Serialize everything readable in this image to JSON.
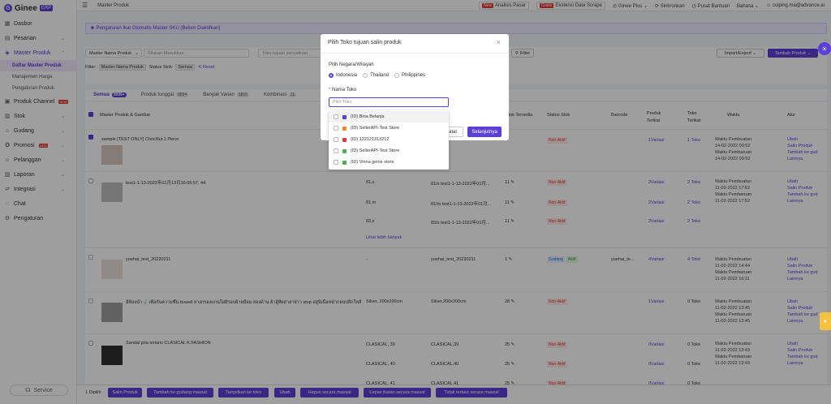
{
  "brand": {
    "name": "Ginee",
    "badge": "ERP"
  },
  "sidebar": {
    "items": [
      {
        "label": "Dasbor",
        "icon": "dashboard-icon"
      },
      {
        "label": "Pesanan",
        "icon": "orders-icon"
      },
      {
        "label": "Master Produk",
        "icon": "product-icon"
      },
      {
        "label": "Produk Channel",
        "icon": "channel-icon",
        "badge": "NEW"
      },
      {
        "label": "Stok",
        "icon": "stock-icon"
      },
      {
        "label": "Gudang",
        "icon": "warehouse-icon"
      },
      {
        "label": "Promosi",
        "icon": "promo-icon",
        "badge": "NEW"
      },
      {
        "label": "Pelanggan",
        "icon": "customer-icon"
      },
      {
        "label": "Laporan",
        "icon": "report-icon"
      },
      {
        "label": "Integrasi",
        "icon": "integration-icon"
      },
      {
        "label": "Chat",
        "icon": "chat-icon"
      },
      {
        "label": "Pengaturan",
        "icon": "settings-icon"
      }
    ],
    "subitems": [
      "Daftar Master Produk",
      "Manajemen Harga",
      "Pengaturan Produk"
    ],
    "service": "Service"
  },
  "topbar": {
    "title": "Master Produk",
    "new_tag": "New",
    "analisis": "Analisis Pasar",
    "gratis_tag": "Gratis",
    "ekstensi": "Ekstensi Data Scrape",
    "plus": "Ginee Plus",
    "sync": "Sinkronkan",
    "help": "Pusat Bantuan",
    "lang": "Bahasa",
    "user": "cuiping.ma@advance.ai"
  },
  "banner": "Pengaturan Ikat Otomatis Master SKU (Belum Diaktifkan)",
  "filters": {
    "field1": "Master Nama Produk",
    "field2": "Silakan Masukkan",
    "field3": "Toko tujuan penyalinan",
    "filter_btn": "Filter",
    "import_export": "Import/Export",
    "add_btn": "Tambah Produk",
    "filter_label": "Filter:",
    "chip1": "Master Nama Produk",
    "status_label": "Status Stok:",
    "chip2": "Semua",
    "reset": "Reset"
  },
  "tabs": [
    {
      "label": "Semua",
      "count": "9999+"
    },
    {
      "label": "Produk tunggal",
      "count": "8804"
    },
    {
      "label": "Banyak Varian",
      "count": "5815"
    },
    {
      "label": "Kombinasi",
      "count": "11"
    }
  ],
  "table": {
    "headers": [
      "Master Produk & Gambar",
      "Stok Tersedia",
      "Status Stok",
      "Barcode",
      "Produk Terikat",
      "Toko Terikat",
      "Waktu",
      "Atur"
    ],
    "rows": [
      {
        "name": "sample [TEST ONLY] ChocNut 1 Piece",
        "variants": [
          {
            "stock": "0",
            "status": "Non-Aktif",
            "produk": "1Variasi",
            "toko": "1 Toko"
          }
        ],
        "waktu": [
          "Waktu Pembuatan",
          "14-02-2022 09:52",
          "Waktu Pembaruan",
          "14-02-2022 09:52"
        ]
      },
      {
        "name": "test1-1-13-2022年01月13日16:05:57.  44",
        "variants": [
          {
            "opt": "81,s",
            "sku": "81/s test1-1-13-2022年01月...",
            "stock": "11",
            "status": "Non-Aktif",
            "produk": "2Variasi",
            "toko": "2 Toko"
          },
          {
            "opt": "81,m",
            "sku": "81/m test1-1-13-2022年01月...",
            "stock": "11",
            "status": "Non-Aktif",
            "produk": "2Variasi",
            "toko": "2 Toko"
          },
          {
            "opt": "83,s",
            "sku": "83/s test1-1-13-2022年01月...",
            "stock": "11",
            "status": "Non-Aktif",
            "produk": "2Variasi",
            "toko": "2 Toko"
          }
        ],
        "more": "Lihat lebih banyak",
        "waktu": [
          "Waktu Pembuatan",
          "11-02-2022 17:52",
          "Waktu Pembaruan",
          "11-02-2022 17:52"
        ]
      },
      {
        "name": "yuehai_test_20220211",
        "variants": [
          {
            "opt": "-",
            "sku": "yuehai_test_20220211",
            "stock": "1",
            "status": "Gudang",
            "status2": "Aktif",
            "barcode": "yuehai_te...",
            "produk": "4Variasi",
            "toko": "4 Toko"
          }
        ],
        "waktu": [
          "Waktu Pembuatan",
          "11-02-2022 14:44",
          "Waktu Pembaruan",
          "11-02-2022 16:11"
        ]
      },
      {
        "name": "มีห้องน้ำ🚽 เพื่อกันความชื้น bowell ยางกรองแกนใยมีรอบผ้ายมือม สองด้าน ผ้าอู้ที่ผลาลาย่าว stop อยู่นีเนื้อหน้ากอนปลีกใหลั้นเมลม",
        "variants": [
          {
            "opt": "Silver, 200x200cm",
            "sku": "Silver,200x200cm",
            "stock": "28",
            "status": "Non-Aktif",
            "produk": "1Variasi",
            "toko": "0 Toko"
          }
        ],
        "waktu": [
          "Waktu Pembuatan",
          "11-02-2022 13:45",
          "Waktu Pembaruan",
          "11-02-2022 13:45"
        ]
      },
      {
        "name": "Sandal pria terlaris CLASICAL K.FASHION",
        "variants": [
          {
            "opt": "CLASICAL, 39",
            "sku": "CLASICAL,39",
            "stock": "25",
            "status": "Non-Aktif",
            "produk": "0Variasi",
            "toko": "0 Toko"
          },
          {
            "opt": "CLASICAL, 40",
            "sku": "CLASICAL,40",
            "stock": "25",
            "status": "Non-Aktif",
            "produk": "0Variasi",
            "toko": "0 Toko"
          },
          {
            "opt": "CLASICAL, 41",
            "sku": "CLASICAL,41",
            "stock": "25",
            "status": "Non-Aktif",
            "produk": "0Variasi",
            "toko": "0 Toko"
          }
        ],
        "waktu": [
          "Waktu Pembuatan",
          "11-02-2022 13:43",
          "Waktu Pembaruan",
          "11-02-2022 13:43"
        ]
      }
    ],
    "actions": [
      "Ubah",
      "Salin Produk",
      "Tambah ke gud",
      "Lainnya"
    ]
  },
  "bottombar": {
    "selected": "1 Dipilih",
    "buttons": [
      "Salin Produk",
      "Tambah ke gudang massal",
      "Tampilkan ke toko",
      "Ubah",
      "Hapus secara massal",
      "Lepas ikatan secara massal",
      "Tidak tertaut secara massal"
    ]
  },
  "modal": {
    "title": "Pilih Toko tujuan salin produk",
    "country_label": "Pilih Negara/Wilayah",
    "countries": [
      "Indonesia",
      "Thailand",
      "Philippines"
    ],
    "store_label": "Nama Toko",
    "placeholder": "Pilih Toko",
    "stores": [
      "(ID) Bina Belanja",
      "(ID) SellerAPI-Test Store",
      "(ID) 122121313212",
      "(ID) SellerAPI-Test Store",
      "(ID) Vinna genie store"
    ],
    "cancel": "Batal",
    "next": "Selanjutnya"
  },
  "colors": {
    "accent": "#5b3fd6",
    "danger": "#e53935"
  }
}
